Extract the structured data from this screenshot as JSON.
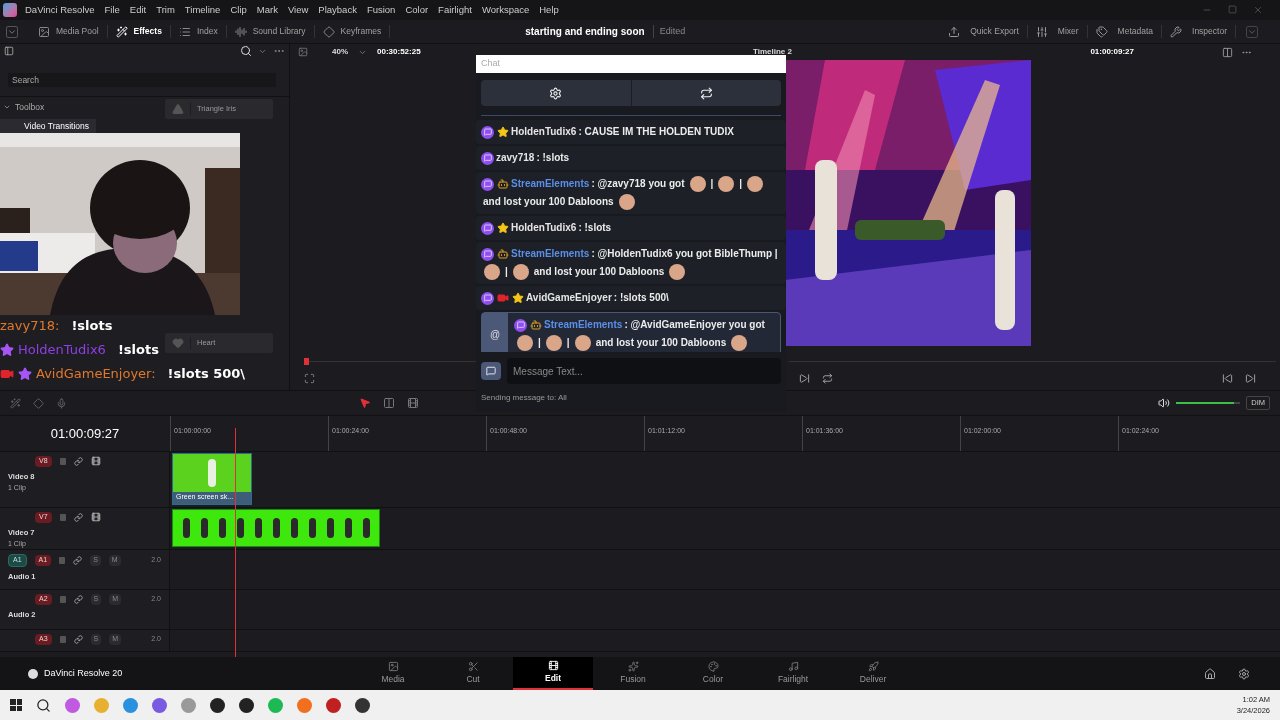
{
  "menu_bar": {
    "app_name": "DaVinci Resolve",
    "items": [
      "File",
      "Edit",
      "Trim",
      "Timeline",
      "Clip",
      "Mark",
      "View",
      "Playback",
      "Fusion",
      "Color",
      "Fairlight",
      "Workspace",
      "Help"
    ]
  },
  "toolbar": {
    "left": [
      {
        "label": "Media Pool",
        "selected": false
      },
      {
        "label": "Effects",
        "selected": true
      },
      {
        "label": "Index",
        "selected": false
      },
      {
        "label": "Sound Library",
        "selected": false
      },
      {
        "label": "Keyframes",
        "selected": false
      }
    ],
    "project_title": "starting and ending soon",
    "status": "Edited",
    "right": [
      "Quick Export",
      "Mixer",
      "Metadata",
      "Inspector"
    ]
  },
  "effects_panel": {
    "search_placeholder": "Search",
    "toolbox": {
      "label": "Toolbox",
      "expanded": true,
      "children": [
        {
          "label": "Video Transitions",
          "selected": true
        }
      ]
    },
    "effects": [
      {
        "label": "Triangle Iris",
        "kind": "triangle"
      },
      {
        "label": "Heart",
        "kind": "heart"
      }
    ]
  },
  "viewer": {
    "zoom": "40%",
    "source_timecode": "00:30:52:25",
    "timeline_name": "Timeline 2",
    "timecode": "01:00:09:27"
  },
  "chat_overlay": [
    {
      "user": "zavy718:",
      "text": "!slots",
      "color": "#e0782c"
    },
    {
      "user": "HoldenTudix6",
      "text": "!slots",
      "color": "#8e3fe6",
      "badges": [
        {
          "kind": "star"
        }
      ]
    },
    {
      "user": "AvidGameEnjoyer:",
      "text": "!slots 500\\",
      "color": "#e0782c",
      "badges": [
        {
          "kind": "camera"
        },
        {
          "kind": "star"
        }
      ]
    }
  ],
  "chat_window": {
    "title": "Chat",
    "messages": [
      {
        "user": "HoldenTudix6",
        "color": "#e6e6e6",
        "badges": [
          {
            "kind": "twitch"
          },
          {
            "kind": "star"
          }
        ],
        "highlighted": false,
        "parts": [
          {
            "kind": "text",
            "text": ": CAUSE IM THE HOLDEN TUDIX"
          }
        ]
      },
      {
        "user": "zavy718",
        "color": "#e6e6e6",
        "badges": [
          {
            "kind": "twitch"
          }
        ],
        "highlighted": false,
        "parts": [
          {
            "kind": "text",
            "text": ": !slots"
          }
        ]
      },
      {
        "user": "StreamElements",
        "color": "#5b8fe8",
        "badges": [
          {
            "kind": "twitch"
          },
          {
            "kind": "bot"
          }
        ],
        "highlighted": false,
        "parts": [
          {
            "kind": "text",
            "text": ": @zavy718 you got"
          },
          {
            "kind": "emote"
          },
          {
            "kind": "text",
            "text": "|"
          },
          {
            "kind": "emote"
          },
          {
            "kind": "text",
            "text": "|"
          },
          {
            "kind": "emote"
          },
          {
            "kind": "text",
            "text": "and lost your 100 Dabloons"
          },
          {
            "kind": "emote"
          }
        ]
      },
      {
        "user": "HoldenTudix6",
        "color": "#e6e6e6",
        "badges": [
          {
            "kind": "twitch"
          },
          {
            "kind": "star"
          }
        ],
        "highlighted": false,
        "parts": [
          {
            "kind": "text",
            "text": ": !slots"
          }
        ]
      },
      {
        "user": "StreamElements",
        "color": "#5b8fe8",
        "badges": [
          {
            "kind": "twitch"
          },
          {
            "kind": "bot"
          }
        ],
        "highlighted": false,
        "parts": [
          {
            "kind": "text",
            "text": ": @HoldenTudix6 you got BibleThump |"
          },
          {
            "kind": "emote"
          },
          {
            "kind": "text",
            "text": "|"
          },
          {
            "kind": "emote"
          },
          {
            "kind": "text",
            "text": "and lost your 100 Dabloons"
          },
          {
            "kind": "emote"
          }
        ]
      },
      {
        "user": "AvidGameEnjoyer",
        "color": "#e6e6e6",
        "badges": [
          {
            "kind": "twitch"
          },
          {
            "kind": "camera"
          },
          {
            "kind": "star"
          }
        ],
        "highlighted": false,
        "parts": [
          {
            "kind": "text",
            "text": ": !slots 500\\"
          }
        ]
      },
      {
        "user": "StreamElements",
        "color": "#5b8fe8",
        "badges": [
          {
            "kind": "twitch"
          },
          {
            "kind": "bot"
          }
        ],
        "highlighted": true,
        "parts": [
          {
            "kind": "text",
            "text": ": @AvidGameEnjoyer you got"
          },
          {
            "kind": "emote"
          },
          {
            "kind": "text",
            "text": "|"
          },
          {
            "kind": "emote"
          },
          {
            "kind": "text",
            "text": "|"
          },
          {
            "kind": "emote"
          },
          {
            "kind": "text",
            "text": "and lost your 100 Dabloons"
          },
          {
            "kind": "emote"
          }
        ]
      }
    ],
    "mention_mark": "@",
    "input_placeholder": "Message Text...",
    "footer": "Sending message to: All"
  },
  "timeline": {
    "timecode": "01:00:09:27",
    "ruler": [
      "01:00:00:00",
      "01:00:24:00",
      "01:00:48:00",
      "01:01:12:00",
      "01:01:36:00",
      "01:02:00:00",
      "01:02:24:00"
    ],
    "tracks": [
      {
        "kind": "video",
        "id": "V8",
        "name": "Video 8",
        "clips": "1 Clip",
        "clip_label": "Green screen sk..."
      },
      {
        "kind": "video",
        "id": "V7",
        "name": "Video 7",
        "clips": "1 Clip"
      },
      {
        "kind": "audio",
        "id": "A1",
        "patch": "A1",
        "name": "Audio 1",
        "solo": "S",
        "mute": "M",
        "level": "2.0"
      },
      {
        "kind": "audio",
        "id": "A2",
        "name": "Audio 2",
        "solo": "S",
        "mute": "M",
        "level": "2.0"
      },
      {
        "kind": "audio",
        "id": "A3",
        "solo": "S",
        "mute": "M",
        "level": "2.0"
      }
    ]
  },
  "volume": {
    "level": 0.9,
    "dim": "DIM"
  },
  "footer": {
    "app": "DaVinci Resolve 20",
    "pages": [
      {
        "label": "Media",
        "selected": false
      },
      {
        "label": "Cut",
        "selected": false
      },
      {
        "label": "Edit",
        "selected": true
      },
      {
        "label": "Fusion",
        "selected": false
      },
      {
        "label": "Color",
        "selected": false
      },
      {
        "label": "Fairlight",
        "selected": false
      },
      {
        "label": "Deliver",
        "selected": false
      }
    ]
  },
  "taskbar": {
    "time": "1:02 AM",
    "date": "3/24/2026"
  }
}
